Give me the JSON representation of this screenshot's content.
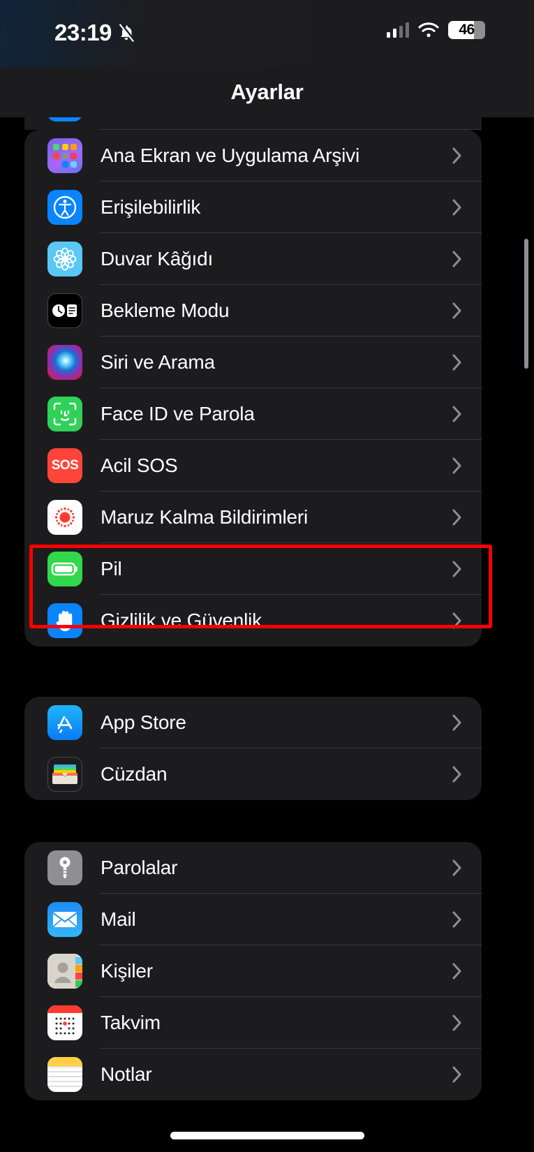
{
  "status_bar": {
    "time": "23:19",
    "mute_icon": "bell-slash-icon",
    "signal_icon": "cellular-signal-icon",
    "wifi_icon": "wifi-icon",
    "battery_percent": "46",
    "battery_icon": "battery-icon"
  },
  "nav": {
    "title": "Ayarlar"
  },
  "colors": {
    "page_background": "#000000",
    "card_background": "#1c1c1e",
    "separator": "#3a3a3c",
    "label": "#ffffff",
    "chevron": "#8e8e93",
    "highlight": "#ff0000"
  },
  "highlight": {
    "target": "Pil"
  },
  "groups": [
    {
      "id": "system-group",
      "rows": [
        {
          "label": "Ana Ekran ve Uygulama Arşivi",
          "icon": "home-screen-icon",
          "chevron": "chevron-right-icon"
        },
        {
          "label": "Erişilebilirlik",
          "icon": "accessibility-icon",
          "chevron": "chevron-right-icon"
        },
        {
          "label": "Duvar Kâğıdı",
          "icon": "wallpaper-icon",
          "chevron": "chevron-right-icon"
        },
        {
          "label": "Bekleme Modu",
          "icon": "standby-icon",
          "chevron": "chevron-right-icon"
        },
        {
          "label": "Siri ve Arama",
          "icon": "siri-icon",
          "chevron": "chevron-right-icon"
        },
        {
          "label": "Face ID ve Parola",
          "icon": "face-id-icon",
          "chevron": "chevron-right-icon"
        },
        {
          "label": "Acil SOS",
          "icon": "sos-icon",
          "icon_text": "SOS",
          "chevron": "chevron-right-icon"
        },
        {
          "label": "Maruz Kalma Bildirimleri",
          "icon": "exposure-notifications-icon",
          "chevron": "chevron-right-icon"
        },
        {
          "label": "Pil",
          "icon": "battery-settings-icon",
          "chevron": "chevron-right-icon"
        },
        {
          "label": "Gizlilik ve Güvenlik",
          "icon": "privacy-hand-icon",
          "chevron": "chevron-right-icon"
        }
      ]
    },
    {
      "id": "store-group",
      "rows": [
        {
          "label": "App Store",
          "icon": "app-store-icon",
          "chevron": "chevron-right-icon"
        },
        {
          "label": "Cüzdan",
          "icon": "wallet-icon",
          "chevron": "chevron-right-icon"
        }
      ]
    },
    {
      "id": "apps-group",
      "rows": [
        {
          "label": "Parolalar",
          "icon": "passwords-key-icon",
          "chevron": "chevron-right-icon"
        },
        {
          "label": "Mail",
          "icon": "mail-icon",
          "chevron": "chevron-right-icon"
        },
        {
          "label": "Kişiler",
          "icon": "contacts-icon",
          "chevron": "chevron-right-icon"
        },
        {
          "label": "Takvim",
          "icon": "calendar-icon",
          "chevron": "chevron-right-icon"
        },
        {
          "label": "Notlar",
          "icon": "notes-icon",
          "chevron": "chevron-right-icon"
        }
      ]
    }
  ]
}
